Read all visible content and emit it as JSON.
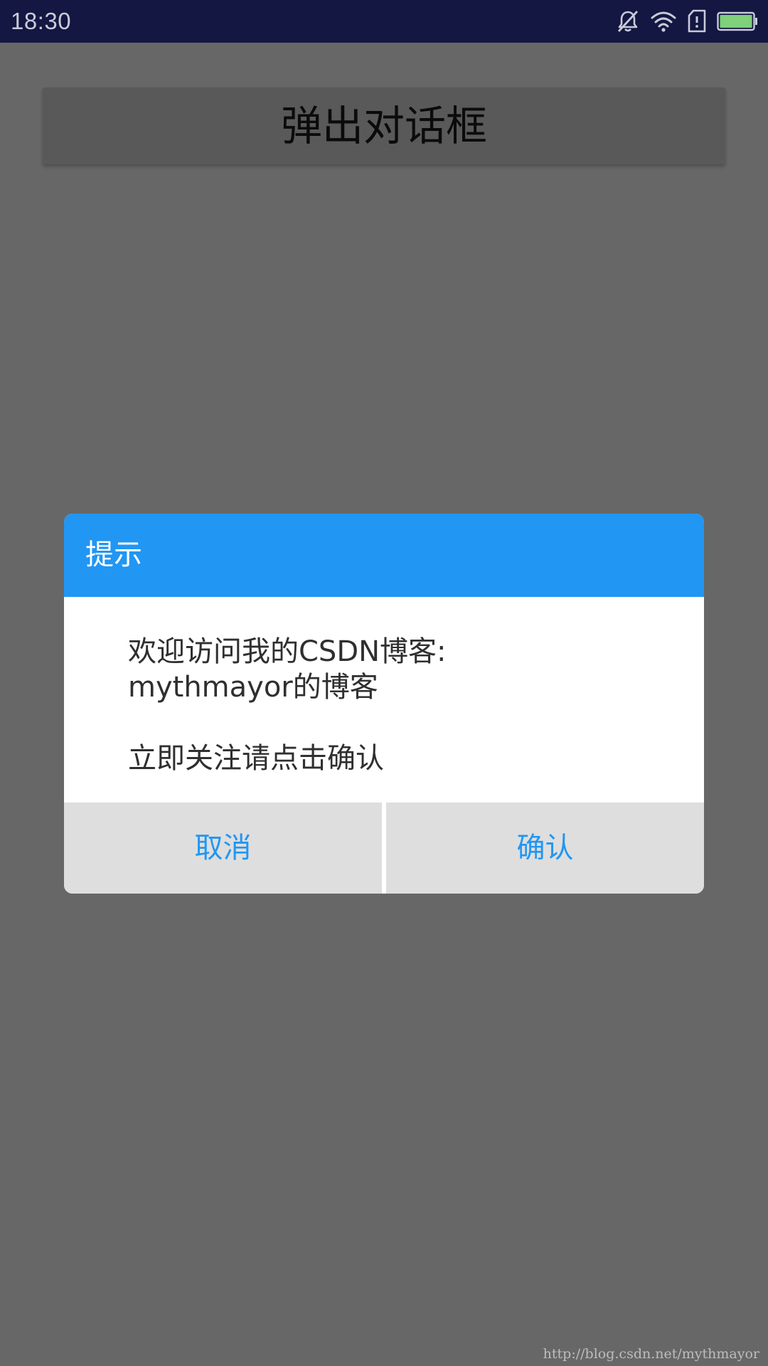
{
  "status_bar": {
    "time": "18:30",
    "icons": [
      "notifications-off-icon",
      "wifi-icon",
      "sim-alert-icon",
      "battery-icon"
    ],
    "battery_color": "#7ed07a"
  },
  "app": {
    "button_label": "弹出对话框"
  },
  "dialog": {
    "title": "提示",
    "header_color": "#2196f3",
    "message": "欢迎访问我的CSDN博客:\nmythmayor的博客\n\n立即关注请点击确认",
    "cancel_label": "取消",
    "confirm_label": "确认",
    "button_text_color": "#2196f3"
  },
  "watermark": "http://blog.csdn.net/mythmayor"
}
